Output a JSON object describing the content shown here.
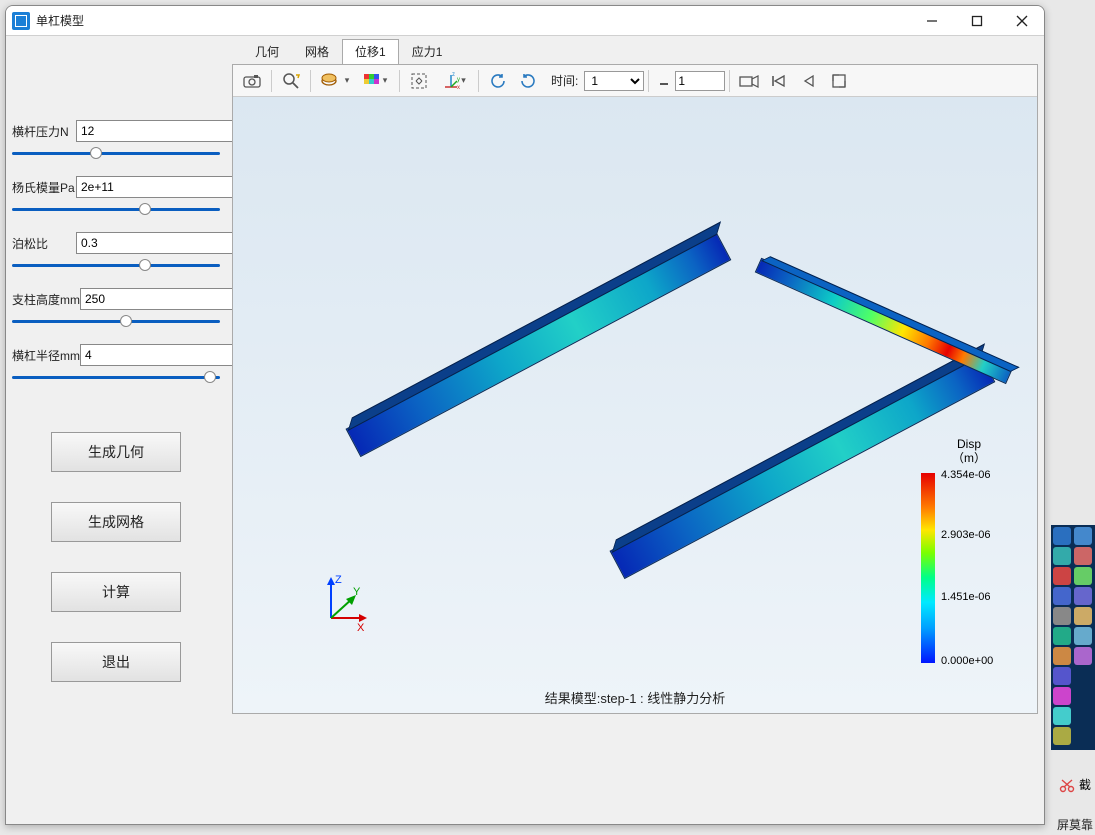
{
  "titlebar": {
    "title": "单杠模型"
  },
  "form": {
    "pressure": {
      "label": "横杆压力N",
      "value": "12",
      "slider": 40
    },
    "young": {
      "label": "杨氏模量Pa",
      "value": "2e+11",
      "slider": 65
    },
    "poisson": {
      "label": "泊松比",
      "value": "0.3",
      "slider": 65
    },
    "height": {
      "label": "支柱高度mm",
      "value": "250",
      "slider": 55
    },
    "radius": {
      "label": "横杠半径mm",
      "value": "4",
      "slider": 98
    }
  },
  "buttons": {
    "gen_geom": "生成几何",
    "gen_mesh": "生成网格",
    "compute": "计算",
    "exit": "退出"
  },
  "tabs": {
    "items": [
      {
        "label": "几何"
      },
      {
        "label": "网格"
      },
      {
        "label": "位移1"
      },
      {
        "label": "应力1"
      }
    ],
    "active_index": 2
  },
  "toolbar": {
    "time_label": "时间:",
    "time_select_value": "1",
    "step_value": "1",
    "icons": {
      "camera": "camera-icon",
      "zoom": "zoom-reset-icon",
      "layers": "layer-toggle-icon",
      "cube": "colormap-icon",
      "extent": "zoom-extent-icon",
      "axes": "axes-mode-icon",
      "rot_ccw": "rotate-ccw-icon",
      "rot_cw": "rotate-cw-icon",
      "video": "animate-icon",
      "first": "first-frame-icon",
      "prev": "prev-frame-icon",
      "last": "last-frame-icon"
    }
  },
  "legend": {
    "title1": "Disp",
    "title2": "（m）",
    "ticks": [
      "4.354e-06",
      "2.903e-06",
      "1.451e-06",
      "0.000e+00"
    ]
  },
  "triad": {
    "x": "X",
    "y": "Y",
    "z": "Z"
  },
  "footer": {
    "caption": "结果模型:step-1 : 线性静力分析"
  },
  "snip": {
    "label": "截",
    "footer": "屏莫靠"
  }
}
